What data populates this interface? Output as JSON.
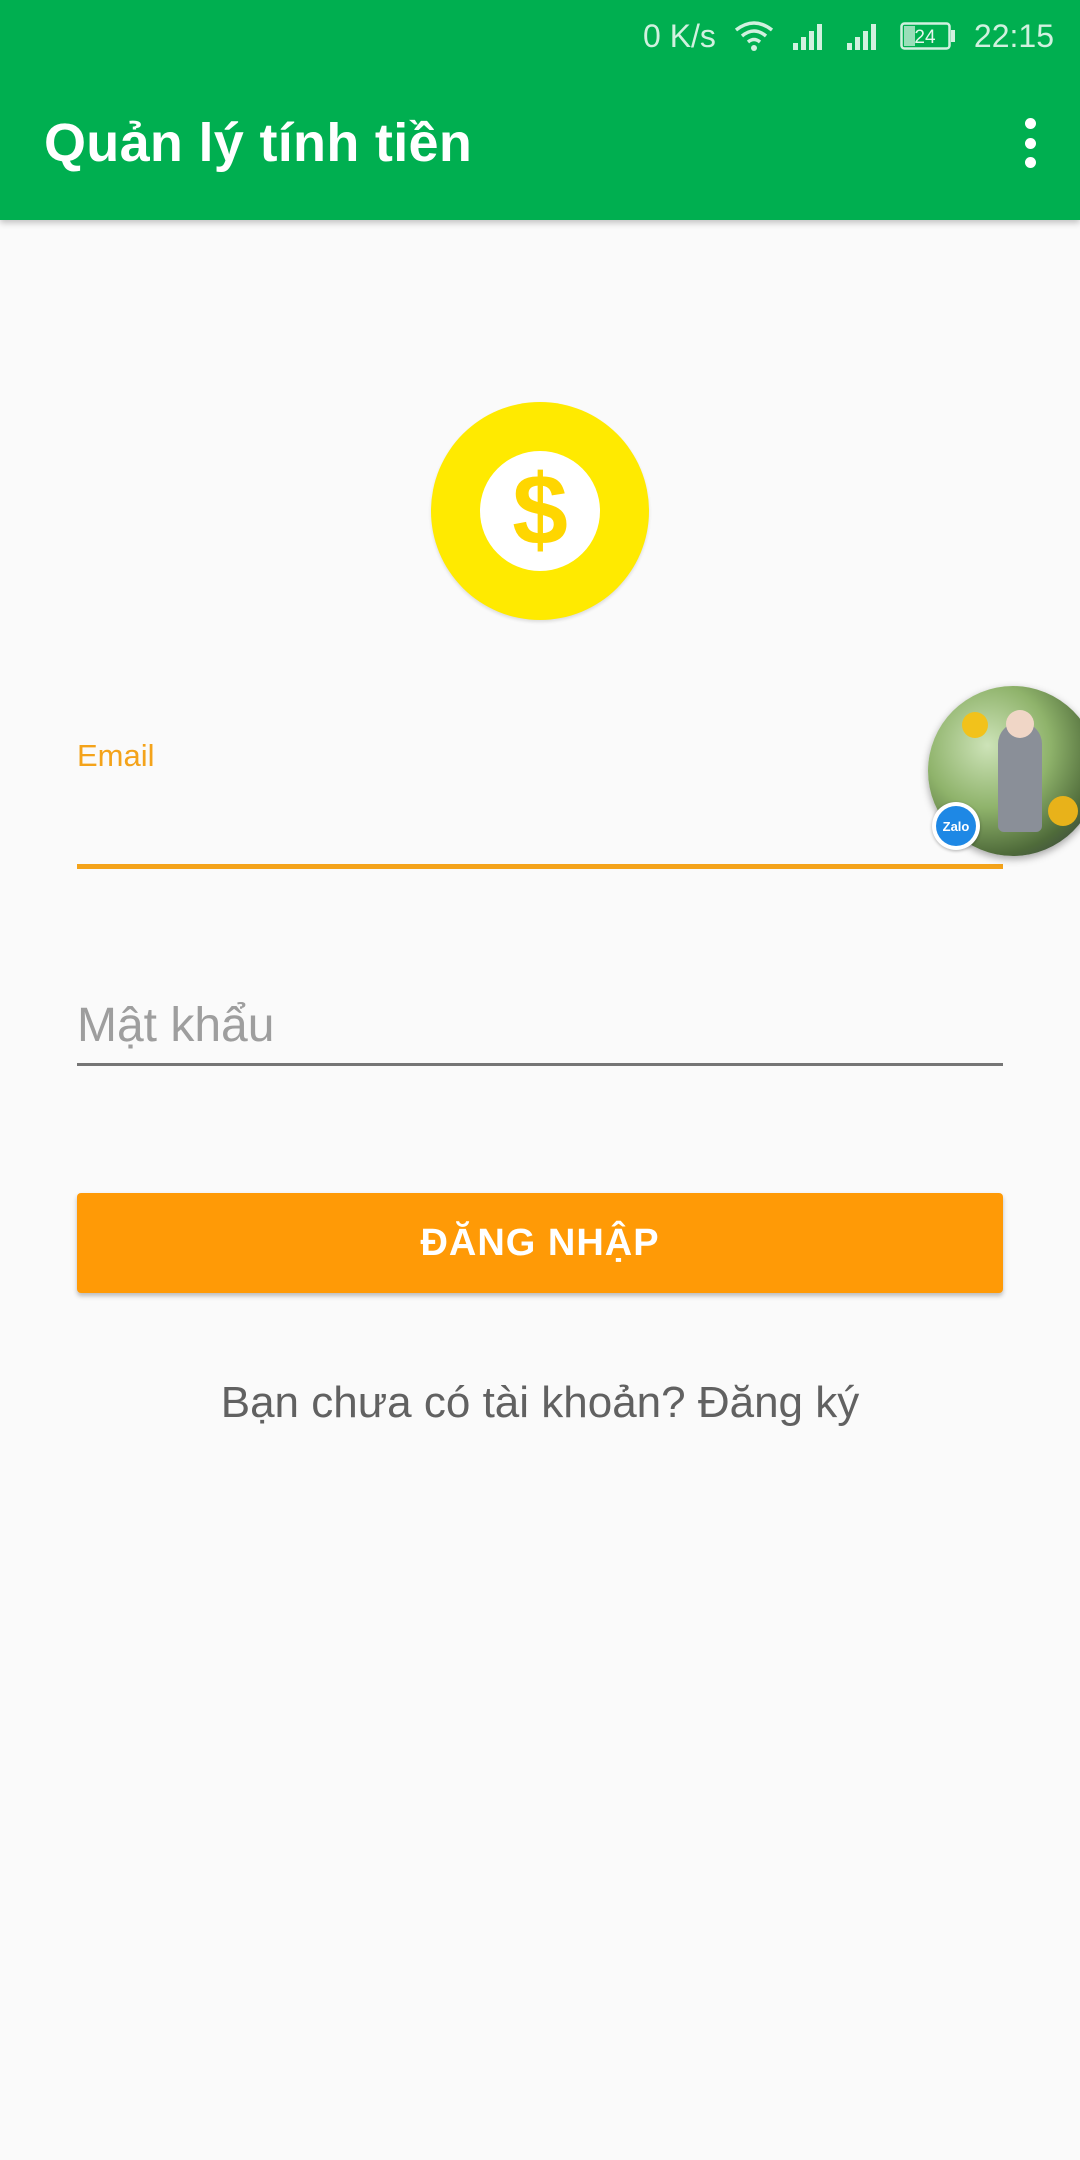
{
  "status_bar": {
    "net_speed": "0 K/s",
    "battery_level": "24",
    "time": "22:15"
  },
  "app_bar": {
    "title": "Quản lý tính tiền",
    "menu_icon": "more-vert-icon"
  },
  "logo": {
    "icon": "dollar-coin-icon",
    "symbol": "$",
    "color": "#FFEA00"
  },
  "form": {
    "email_label": "Email",
    "email_value": "",
    "password_placeholder": "Mật khẩu",
    "login_button": "ĐĂNG NHẬP",
    "signup_prompt": "Bạn chưa có tài khoản? Đăng ký"
  },
  "chat_head": {
    "icon": "zalo-chat-head",
    "badge": "Zalo"
  },
  "colors": {
    "primary": "#00AF50",
    "accent": "#FF9A06",
    "label": "#F4A31A"
  }
}
